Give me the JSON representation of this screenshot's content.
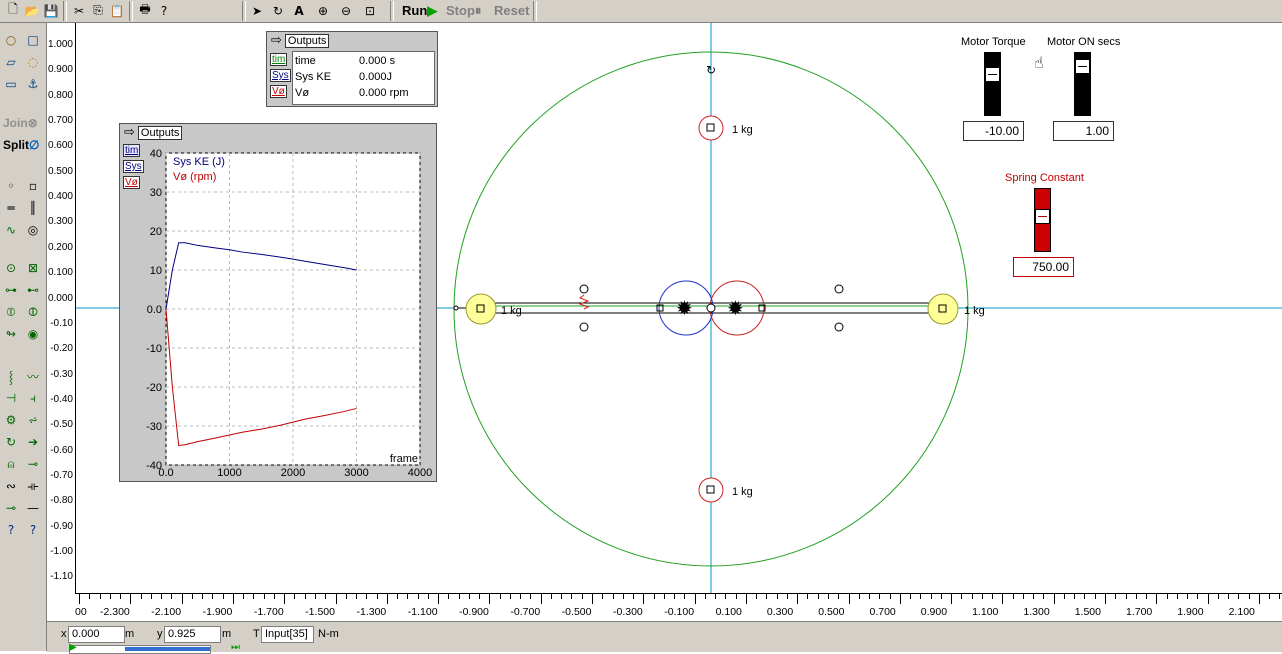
{
  "toolbar": {
    "run_label": "Run",
    "stop_label": "Stop",
    "reset_label": "Reset"
  },
  "palette": {
    "join_label": "Join",
    "split_label": "Split"
  },
  "rulers": {
    "vertical": [
      "1.000",
      "0.900",
      "0.800",
      "0.700",
      "0.600",
      "0.500",
      "0.400",
      "0.300",
      "0.200",
      "0.100",
      "0.000",
      "-0.10",
      "-0.20",
      "-0.30",
      "-0.40",
      "-0.50",
      "-0.60",
      "-0.70",
      "-0.80",
      "-0.90",
      "-1.00",
      "-1.10"
    ],
    "horizontal": [
      "00",
      "-2.300",
      "-2.100",
      "-1.900",
      "-1.700",
      "-1.500",
      "-1.300",
      "-1.100",
      "-0.900",
      "-0.700",
      "-0.500",
      "-0.300",
      "-0.100",
      "0.100",
      "0.300",
      "0.500",
      "0.700",
      "0.900",
      "1.100",
      "1.300",
      "1.500",
      "1.700",
      "1.900",
      "2.100"
    ]
  },
  "outputs_small": {
    "title": "Outputs",
    "rows": [
      {
        "btn": "tim",
        "name": "time",
        "value": "0.000 s",
        "color": "#008000"
      },
      {
        "btn": "Sys",
        "name": "Sys KE",
        "value": "0.000J",
        "color": "#000080"
      },
      {
        "btn": "Vø",
        "name": "Vø",
        "value": "0.000 rpm",
        "color": "#c00000"
      }
    ]
  },
  "outputs_graph": {
    "title": "Outputs",
    "buttons": [
      "tim",
      "Sys",
      "Vø"
    ]
  },
  "chart_data": {
    "type": "line",
    "x": [
      0,
      100,
      200,
      300,
      500,
      800,
      1000,
      1200,
      1500,
      1800,
      2000,
      2200,
      2500,
      2800,
      3000
    ],
    "series": [
      {
        "name": "Sys KE (J)",
        "color": "#000080",
        "values": [
          0,
          10,
          17,
          17,
          16.3,
          15.6,
          15.2,
          14.6,
          14,
          13.3,
          12.8,
          12.2,
          11.4,
          10.6,
          10
        ]
      },
      {
        "name": "Vø (rpm)",
        "color": "#c00000",
        "values": [
          0,
          -20,
          -35,
          -34.8,
          -34,
          -33,
          -32.3,
          -31.6,
          -30.8,
          -29.8,
          -29,
          -28.2,
          -27.3,
          -26.3,
          -25.5
        ]
      }
    ],
    "xlabel": "frame",
    "xlim": [
      0,
      4000
    ],
    "ylim": [
      -40,
      40
    ],
    "xticks": [
      "0.0",
      "1000",
      "2000",
      "3000",
      "4000"
    ],
    "yticks": [
      "40",
      "30",
      "20",
      "10",
      "0.0",
      "-10",
      "-20",
      "-30",
      "-40"
    ],
    "grid": true,
    "legend_position": "top-left"
  },
  "canvas": {
    "mass_labels": [
      "1 kg",
      "1 kg",
      "1 kg",
      "1 kg"
    ]
  },
  "motor_torque": {
    "label": "Motor Torque",
    "value": "-10.00",
    "level": 0.7
  },
  "motor_on": {
    "label": "Motor ON secs",
    "value": "1.00",
    "level": 0.85
  },
  "spring": {
    "label": "Spring Constant",
    "value": "750.00",
    "level": 0.6
  },
  "status": {
    "x_label": "x",
    "x_value": "0.000",
    "x_unit": "m",
    "y_label": "y",
    "y_value": "0.925",
    "y_unit": "m",
    "t_label": "T",
    "t_value": "Input[35]",
    "t_unit": "N-m"
  }
}
